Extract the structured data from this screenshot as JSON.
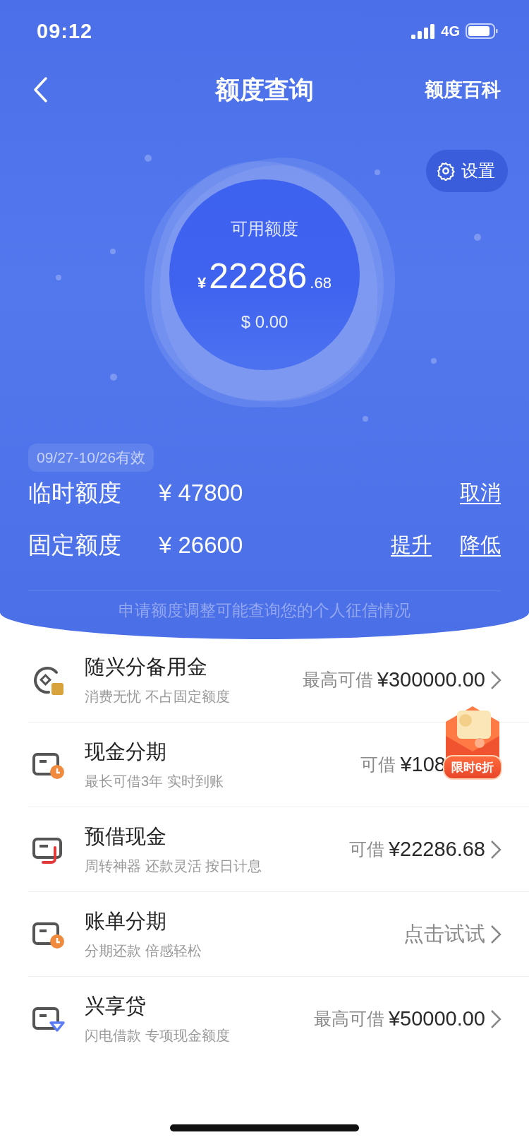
{
  "status_bar": {
    "time": "09:12",
    "network": "4G"
  },
  "nav": {
    "title": "额度查询",
    "action": "额度百科"
  },
  "settings_button": {
    "label": "设置"
  },
  "available": {
    "label": "可用额度",
    "currency": "¥",
    "integer": "22286",
    "decimals": ".68",
    "usd": "$ 0.00"
  },
  "limits": {
    "validity": "09/27-10/26有效",
    "rows": [
      {
        "label": "临时额度",
        "value": "¥ 47800",
        "actions": [
          "取消"
        ]
      },
      {
        "label": "固定额度",
        "value": "¥ 26600",
        "actions": [
          "提升",
          "降低"
        ]
      }
    ],
    "note": "申请额度调整可能查询您的个人征信情况"
  },
  "products": [
    {
      "kind": "coin",
      "title": "随兴分备用金",
      "subtitle": "消费无忧 不占固定额度",
      "prefix": "最高可借",
      "amount": "¥300000.00",
      "chevron": true
    },
    {
      "kind": "card-clock",
      "title": "现金分期",
      "subtitle": "最长可借3年 实时到账",
      "prefix": "可借",
      "amount": "¥108",
      "chevron": false,
      "promo": "限时6折"
    },
    {
      "kind": "card-hook",
      "title": "预借现金",
      "subtitle": "周转神器 还款灵活 按日计息",
      "prefix": "可借",
      "amount": "¥22286.68",
      "chevron": true
    },
    {
      "kind": "card-clock",
      "title": "账单分期",
      "subtitle": "分期还款 倍感轻松",
      "prefix": "点击试试",
      "chevron": true
    },
    {
      "kind": "card-diamond",
      "title": "兴享贷",
      "subtitle": "闪电借款 专项现金额度",
      "prefix": "最高可借",
      "amount": "¥50000.00",
      "chevron": true
    }
  ]
}
